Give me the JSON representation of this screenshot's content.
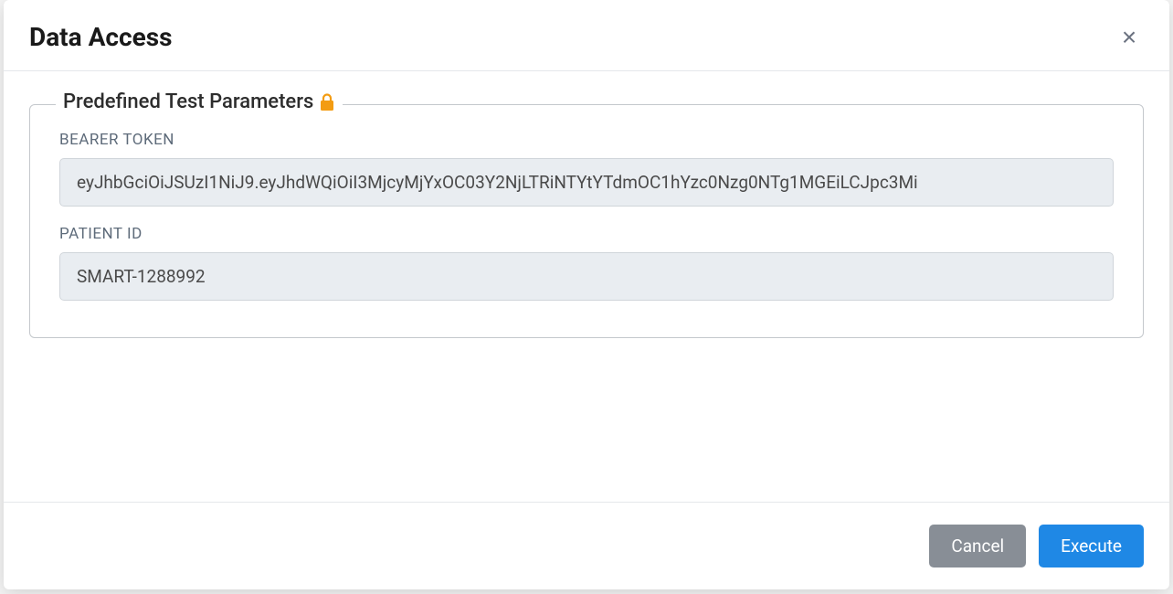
{
  "modal": {
    "title": "Data Access",
    "close_label": "×"
  },
  "fieldset": {
    "legend": "Predefined Test Parameters"
  },
  "fields": {
    "bearer_token": {
      "label": "BEARER TOKEN",
      "value": "eyJhbGciOiJSUzI1NiJ9.eyJhdWQiOiI3MjcyMjYxOC03Y2NjLTRiNTYtYTdmOC1hYzc0Nzg0NTg1MGEiLCJpc3Mi"
    },
    "patient_id": {
      "label": "PATIENT ID",
      "value": "SMART-1288992"
    }
  },
  "footer": {
    "cancel_label": "Cancel",
    "execute_label": "Execute"
  }
}
